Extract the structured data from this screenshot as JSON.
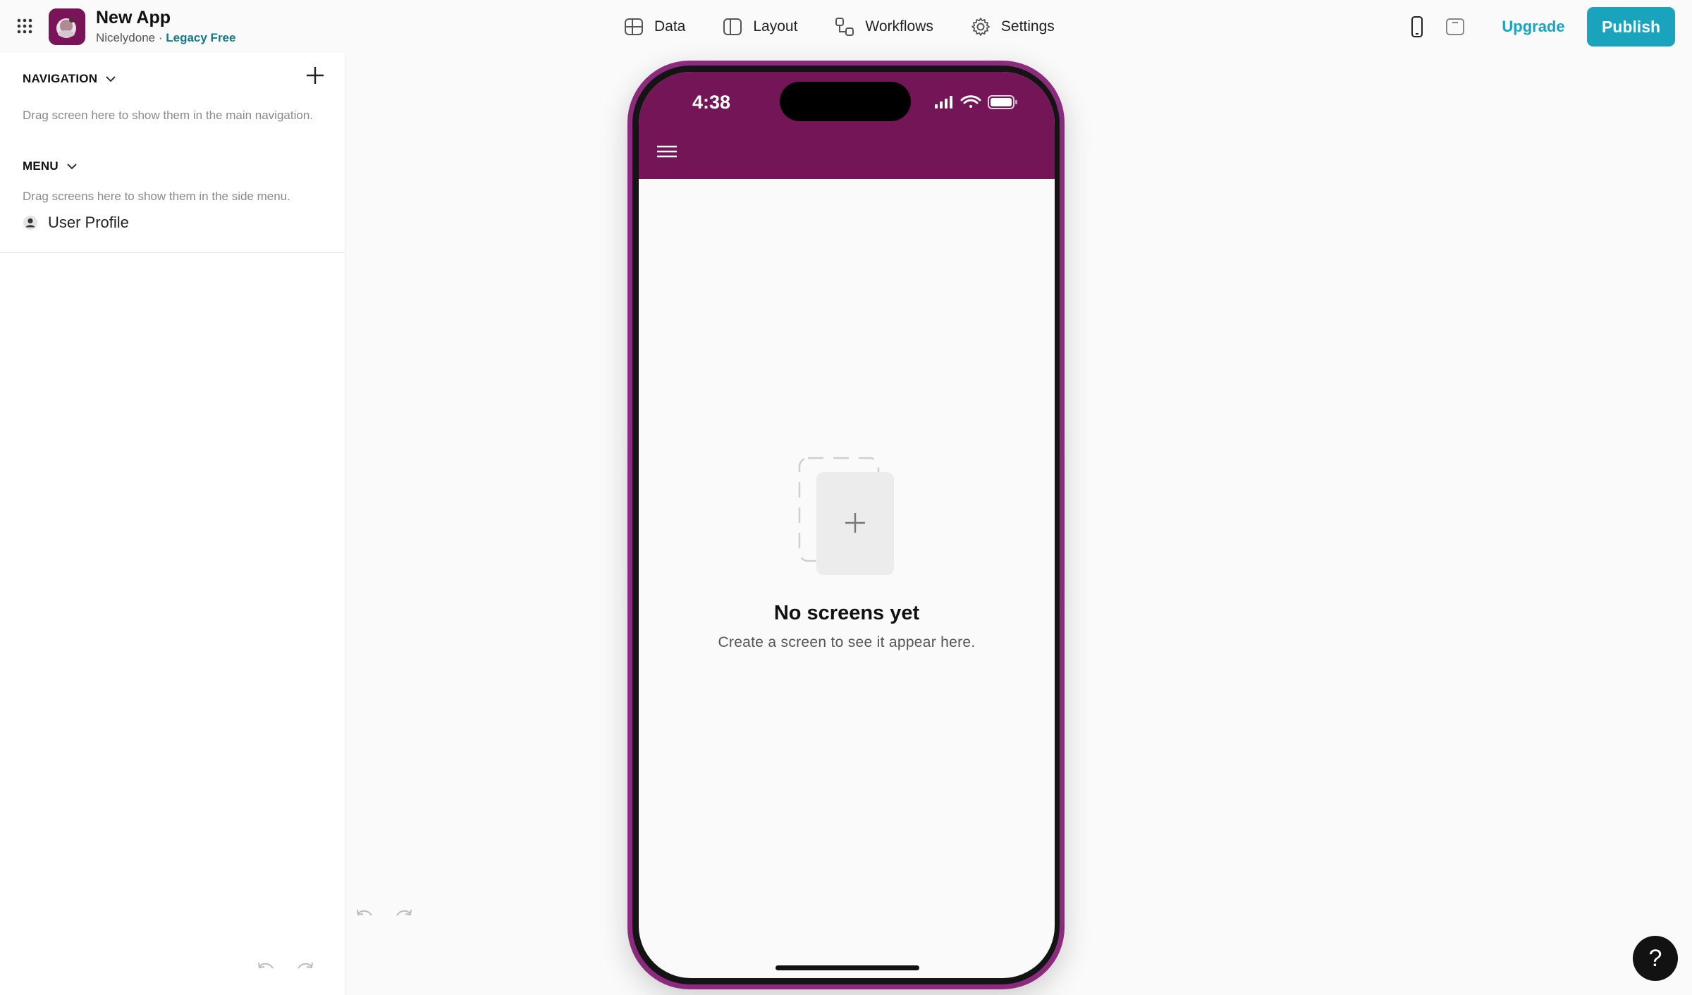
{
  "app": {
    "name": "New App",
    "team": "Nicelydone",
    "separator": "·",
    "plan": "Legacy Free"
  },
  "nav": {
    "tabs": [
      {
        "label": "Data",
        "icon": "table-icon"
      },
      {
        "label": "Layout",
        "icon": "layout-icon"
      },
      {
        "label": "Workflows",
        "icon": "workflows-icon"
      },
      {
        "label": "Settings",
        "icon": "gear-icon"
      }
    ]
  },
  "toolbar": {
    "upgrade_label": "Upgrade",
    "publish_label": "Publish"
  },
  "sidebar": {
    "navigation": {
      "title": "NAVIGATION",
      "hint": "Drag screen here to show them in the main navigation."
    },
    "menu": {
      "title": "MENU",
      "hint": "Drag screens here to show them in the side menu.",
      "items": [
        {
          "label": "User Profile",
          "icon": "user-icon"
        }
      ]
    }
  },
  "phone": {
    "status_time": "4:38",
    "empty_title": "No screens yet",
    "empty_subtitle": "Create a screen to see it appear here.",
    "header_color": "#731557"
  },
  "help": {
    "label": "?"
  },
  "colors": {
    "accent": "#1aa3bd",
    "plan": "#137a8c",
    "brand": "#731557"
  }
}
